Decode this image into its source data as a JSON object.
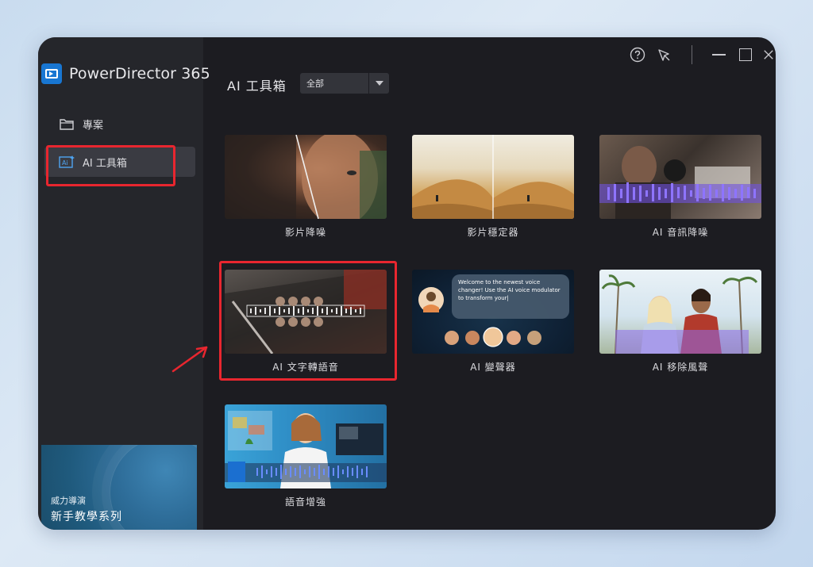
{
  "app": {
    "name": "PowerDirector 365"
  },
  "sidebar": {
    "items": [
      {
        "label": "專案",
        "icon": "folder-icon"
      },
      {
        "label": "AI 工具箱",
        "icon": "ai-toolbox-icon"
      }
    ],
    "tutorial": {
      "subtitle": "威力導演",
      "title": "新手教學系列"
    }
  },
  "main": {
    "title": "AI 工具箱",
    "filter": {
      "value": "全部"
    },
    "tools": [
      {
        "label": "影片降噪"
      },
      {
        "label": "影片穩定器"
      },
      {
        "label": "AI 音訊降噪"
      },
      {
        "label": "AI 文字轉語音"
      },
      {
        "label": "AI 變聲器"
      },
      {
        "label": "AI 移除風聲"
      },
      {
        "label": "語音增強"
      }
    ],
    "voice_changer_bubble": "Welcome to the newest voice changer! Use the AI voice modulator to transform your|"
  },
  "window_controls": [
    "help-icon",
    "feedback-icon",
    "minimize-icon",
    "maximize-icon",
    "close-icon"
  ],
  "colors": {
    "accent": "#1876d2",
    "highlight": "#e8262f",
    "background": "#1c1c21",
    "sidebar": "#25262b"
  }
}
